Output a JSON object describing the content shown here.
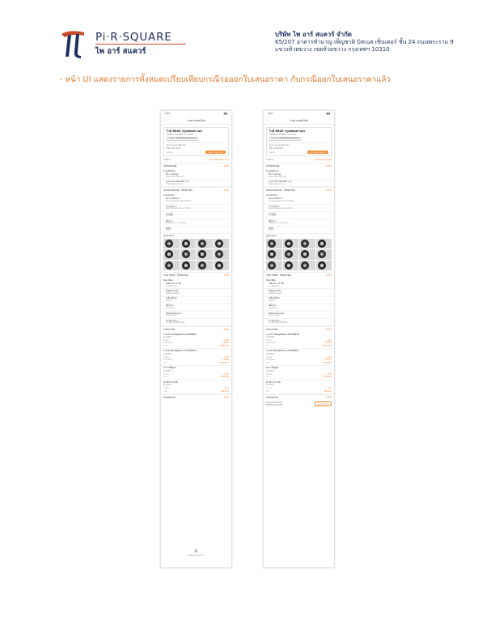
{
  "header": {
    "logo_text": "Pi·R·SQUARE",
    "logo_sub": "ไพ อาร์ สแควร์",
    "company_name": "บริษัท ไพ อาร์ สแควร์ จำกัด",
    "address_line1": "65/207 อาคารชำนาญ เพ็ญชาติ บิสเนส เซ็นเตอร์ ชั้น 24 ถนนพระราม 9",
    "address_line2": "แขวงห้วยขวาง เขตห้วยขวาง กรุงเทพฯ 10310"
  },
  "caption": "- หน้า UI แสดงรายการทั้งหมดเปรียบเทียบกรณีรอออกใบเสนอราคา กับกรณีออกใบเสนอราคาแล้ว",
  "colors": {
    "accent": "#e87a2a",
    "brand_navy": "#1f2f5e",
    "brand_red": "#c94a2a"
  },
  "icons": {
    "back": "chevron-left-icon",
    "search": "search-icon"
  },
  "phone_left": {
    "time": "9:41",
    "battery": "▮▮▮",
    "nav_title": "รายการเคลมใหม่",
    "back_glyph": "‹",
    "car_title": "ไวท์ 8542 กรุงเทพมหานคร",
    "car_sub": "HONDA ACCORD 2.4 (2013)",
    "plate": "เลขตัวถัง MRHCP3650DP000000",
    "claimant": "ผู้แจ้ง: คุณสมหญิง ใจดี",
    "phone": "081-234-5678",
    "status_label": "สถานะ",
    "status_pill": "รอออกใบเสนอราคา",
    "line_label": "รายการ",
    "line_value": "แสดงเปรียบเทียบราคา",
    "sections": [
      {
        "head": "ประกันรถยนต์",
        "edit": "แก้ไข",
        "label": "ความคุ้มครอง",
        "items": [
          {
            "t": "ชั้น 1 (ซ่อมอู่)",
            "d": "คุ้มครองทั้งรถและคู่กรณี"
          },
          {
            "t": "ทุนประกัน 500,000 บาท",
            "d": "ไม่มีค่าเสียหายส่วนแรก"
          }
        ]
      },
      {
        "head": "สภาพยางรถยนต์ - ได้รับคำร้อง",
        "edit": "แก้ไข",
        "label": "ยางหน้าซ้าย",
        "items": [
          {
            "t": "ดอกยางสึกหรอ",
            "d": "ตรวจพบรอยแตกร้าวบริเวณแก้มยาง"
          },
          {
            "t": "ยางหน้าขวา",
            "d": "ดอกยางสึกหรอตามอายุการใช้งาน"
          },
          {
            "t": "ยางหลัง",
            "d": "สภาพปกติ"
          },
          {
            "t": "ยี่ห้อยาง",
            "d": "Bridgestone 215/60R16"
          },
          {
            "t": "ปีผลิต",
            "d": "2019"
          }
        ]
      }
    ],
    "photos_label": "รูปสภาพยาง",
    "section3": {
      "head": "รายการซ่อม - ได้รับคำร้อง",
      "edit": "แก้ไข",
      "label": "ปัญหาที่พบ",
      "items": [
        {
          "t": "เปลี่ยนยาง 4 เส้น",
          "d": "ยางเสื่อมสภาพ"
        },
        {
          "t": "ตั้งศูนย์ถ่วงล้อ",
          "d": "ล้อหน้าไม่ตรงศูนย์"
        },
        {
          "t": "เปลี่ยนจุ๊บลม",
          "d": "จุ๊บลมรั่ว"
        },
        {
          "t": "สลับยาง",
          "d": "สึกไม่เท่ากัน"
        },
        {
          "t": "เติมลมไนโตรเจน",
          "d": "รักษาแรงดันลม"
        },
        {
          "t": "ตรวจช่วงล่าง",
          "d": "ตรวจสภาพช่วงล่างทั้งหมด"
        }
      ]
    },
    "section4": {
      "head": "ราคาอะไหล่",
      "edit": "แก้ไข",
      "quotes": [
        {
          "name": "ยางหน้า Bridgestone 215/60R16",
          "code": "CJ-00082",
          "qty_label": "จำนวน",
          "qty": "2 เส้น",
          "unit_label": "ราคา/หน่วย",
          "unit": "3,500 ฿",
          "total_label": "รวม",
          "total": "7,000.00 ฿"
        },
        {
          "name": "ยางหลัง Bridgestone 215/60R16",
          "code": "CJ-00083",
          "qty_label": "จำนวน",
          "qty": "2 เส้น",
          "unit_label": "ราคา/หน่วย",
          "unit": "3,500 ฿",
          "total_label": "รวม",
          "total": "7,000.00 ฿"
        },
        {
          "name": "ค่าแรงตั้งศูนย์",
          "code": "CJ-00084",
          "qty_label": "จำนวน",
          "qty": "1 ครั้ง",
          "unit_label": "รวม",
          "unit": "600.00 ฿",
          "total_label": "",
          "total": ""
        },
        {
          "name": "ค่าบริการถ่วงล้อ",
          "code": "CJ-00085",
          "qty_label": "จำนวน",
          "qty": "4 ล้อ",
          "unit_label": "รวม",
          "unit": "400.00 ฿",
          "total_label": "",
          "total": ""
        }
      ]
    },
    "section5": {
      "head": "ใบเสนอราคา",
      "edit": "แก้ไข"
    },
    "search_label": "ค้นหาใบเสนอราคา"
  },
  "phone_right": {
    "time": "9:41",
    "battery": "▮▮▮",
    "nav_title": "รายการเคลมใหม่",
    "back_glyph": "‹",
    "car_title": "ไวท์ 8542 กรุงเทพมหานคร",
    "car_sub": "HONDA ACCORD 2.4 (2013)",
    "plate": "เลขตัวถัง MRHCP3650DP000000",
    "claimant": "ผู้แจ้ง: คุณสมหญิง ใจดี",
    "phone": "081-234-5678",
    "status_label": "สถานะ",
    "status_pill": "ออกใบเสนอราคาแล้ว",
    "line_label": "รายการ",
    "line_value": "ใบเสนอราคาล่าสุด",
    "sections": [
      {
        "head": "ประกันรถยนต์",
        "edit": "แก้ไข",
        "label": "ความคุ้มครอง",
        "items": [
          {
            "t": "ชั้น 1 (ซ่อมอู่)",
            "d": "คุ้มครองทั้งรถและคู่กรณี"
          },
          {
            "t": "ทุนประกัน 500,000 บาท",
            "d": "ไม่มีค่าเสียหายส่วนแรก"
          }
        ]
      },
      {
        "head": "สภาพยางรถยนต์ - ได้รับคำร้อง",
        "edit": "แก้ไข",
        "label": "ยางหน้าซ้าย",
        "items": [
          {
            "t": "ดอกยางสึกหรอ",
            "d": "ตรวจพบรอยแตกร้าวบริเวณแก้มยาง"
          },
          {
            "t": "ยางหน้าขวา",
            "d": "ดอกยางสึกหรอตามอายุการใช้งาน"
          },
          {
            "t": "ยางหลัง",
            "d": "สภาพปกติ"
          },
          {
            "t": "ยี่ห้อยาง",
            "d": "Bridgestone 215/60R16"
          },
          {
            "t": "ปีผลิต",
            "d": "2019"
          }
        ]
      }
    ],
    "photos_label": "รูปสภาพยาง",
    "section3": {
      "head": "รายการซ่อม - ได้รับคำร้อง",
      "edit": "แก้ไข",
      "label": "ปัญหาที่พบ",
      "items": [
        {
          "t": "เปลี่ยนยาง 4 เส้น",
          "d": "ยางเสื่อมสภาพ"
        },
        {
          "t": "ตั้งศูนย์ถ่วงล้อ",
          "d": "ล้อหน้าไม่ตรงศูนย์"
        },
        {
          "t": "เปลี่ยนจุ๊บลม",
          "d": "จุ๊บลมรั่ว"
        },
        {
          "t": "สลับยาง",
          "d": "สึกไม่เท่ากัน"
        },
        {
          "t": "เติมลมไนโตรเจน",
          "d": "รักษาแรงดันลม"
        },
        {
          "t": "ตรวจช่วงล่าง",
          "d": "ตรวจสภาพช่วงล่างทั้งหมด"
        }
      ]
    },
    "section4": {
      "head": "ราคาอะไหล่",
      "edit": "แก้ไข",
      "quotes": [
        {
          "name": "ยางหน้า Bridgestone 215/60R16",
          "code": "CJ-00082",
          "qty_label": "จำนวน",
          "qty": "2 เส้น",
          "unit_label": "ราคา/หน่วย",
          "unit": "3,500 ฿",
          "total_label": "รวม",
          "total": "7,000.00 ฿"
        },
        {
          "name": "ยางหลัง Bridgestone 215/60R16",
          "code": "CJ-00083",
          "qty_label": "จำนวน",
          "qty": "2 เส้น",
          "unit_label": "ราคา/หน่วย",
          "unit": "3,500 ฿",
          "total_label": "รวม",
          "total": "7,000.00 ฿"
        },
        {
          "name": "ค่าแรงตั้งศูนย์",
          "code": "CJ-00084",
          "qty_label": "จำนวน",
          "qty": "1 ครั้ง",
          "unit_label": "รวม",
          "unit": "600.00 ฿",
          "total_label": "",
          "total": ""
        },
        {
          "name": "ค่าบริการถ่วงล้อ",
          "code": "CJ-00085",
          "qty_label": "จำนวน",
          "qty": "4 ล้อ",
          "unit_label": "รวม",
          "unit": "400.00 ฿",
          "total_label": "",
          "total": ""
        }
      ]
    },
    "section5": {
      "head": "ใบเสนอราคา",
      "edit": "แก้ไข"
    },
    "quote_doc_label": "ใบเสนอราคาเลขที่",
    "quote_doc_no": "QT20211102-001",
    "quote_doc_btn": "ดูใบเสนอราคา"
  }
}
